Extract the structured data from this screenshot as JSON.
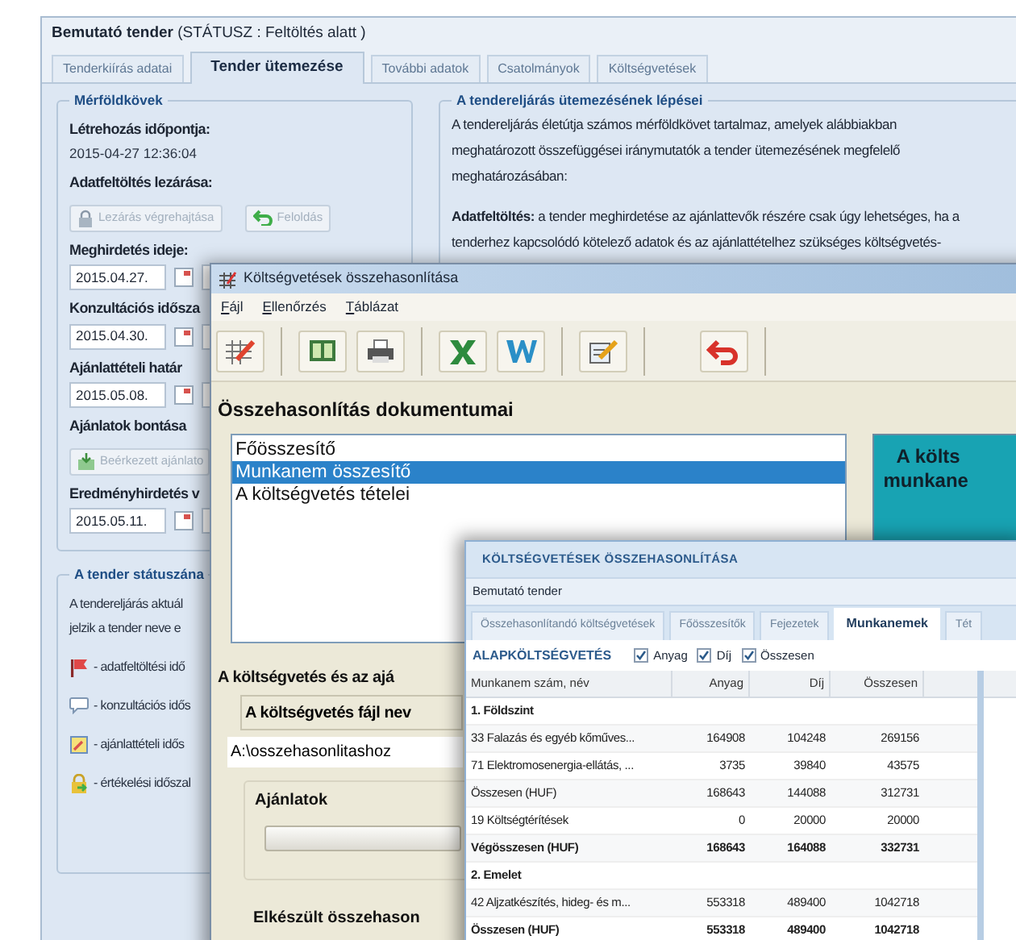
{
  "back_window": {
    "title": "**Bemutató tender** (STÁTUSZ : Feltöltés alatt )",
    "tabs": [
      {
        "label": "Tenderkiírás adatai",
        "selected": false
      },
      {
        "label": "Tender ütemezése",
        "selected": true
      },
      {
        "label": "További adatok",
        "selected": false
      },
      {
        "label": "Csatolmányok",
        "selected": false
      },
      {
        "label": "Költségvetések",
        "selected": false
      }
    ],
    "milestones": {
      "legend": "Mérföldkövek",
      "items": [
        {
          "kind": "label",
          "text": "Létrehozás időpontja:"
        },
        {
          "kind": "value",
          "text": "2015-04-27 12:36:04"
        },
        {
          "kind": "label",
          "text": "Adatfeltöltés lezárása:"
        },
        {
          "kind": "buttons",
          "buttons": [
            {
              "kind": "lock",
              "label": "Lezárás végrehajtása",
              "disabled": true
            },
            {
              "kind": "undo",
              "label": "Feloldás",
              "disabled": true
            }
          ]
        },
        {
          "kind": "label",
          "text": "Meghirdetés ideje:"
        },
        {
          "kind": "date",
          "value": "2015.04.27."
        },
        {
          "kind": "label",
          "text": "Konzultációs idősza"
        },
        {
          "kind": "date",
          "value": "2015.04.30."
        },
        {
          "kind": "label",
          "text": "Ajánlattételi határ"
        },
        {
          "kind": "date",
          "value": "2015.05.08."
        },
        {
          "kind": "label",
          "text": "Ajánlatok bontása"
        },
        {
          "kind": "buttons",
          "buttons": [
            {
              "kind": "inbox",
              "label": "Beérkezett ajánlato",
              "disabled": true
            }
          ]
        },
        {
          "kind": "label",
          "text": "Eredményhirdetés v"
        },
        {
          "kind": "date",
          "value": "2015.05.11."
        }
      ]
    },
    "status": {
      "legend": "A tender státuszána",
      "lines": [
        "A tendereljárás aktuál",
        "jelzik a tender neve e"
      ],
      "legend_items": [
        {
          "kind": "flag",
          "text": "- adatfeltöltési idő"
        },
        {
          "kind": "bubble",
          "text": "- konzultációs idős"
        },
        {
          "kind": "note",
          "text": "- ajánlattételi idős"
        },
        {
          "kind": "lock",
          "text": "- értékelési időszal"
        }
      ]
    },
    "steps": {
      "legend": "A tendereljárás ütemezésének lépései",
      "paragraphs": [
        "A tendereljárás életútja számos mérföldkövet tartalmaz, amelyek alábbiakban meghatározott összefüggései iránymutatók a tender ütemezésének megfelelő meghatározásában:",
        "**Adatfeltöltés:** a tender meghirdetése az ajánlattevők részére csak úgy lehetséges, ha a tenderhez kapcsolódó kötelező adatok és az ajánlattételhez szükséges költségvetés-"
      ]
    }
  },
  "middle_window": {
    "title": "Költségvetések összehasonlítása",
    "menu": [
      "Fájl",
      "Ellenőrzés",
      "Táblázat"
    ],
    "documents_heading": "Összehasonlítás dokumentumai",
    "documents": [
      {
        "label": "Főösszesítő",
        "selected": false
      },
      {
        "label": "Munkanem összesítő",
        "selected": true
      },
      {
        "label": "A költségvetés tételei",
        "selected": false
      }
    ],
    "info_panel": [
      "A költs",
      "munkane"
    ],
    "section_heading": "A költségvetés és az ajá",
    "file_label": "A költségvetés fájl nev",
    "file_path": "A:\\osszehasonlitashoz",
    "offers_heading": "Ajánlatok",
    "done_heading": "Elkészült összehason"
  },
  "front_window": {
    "title": "KÖLTSÉGVETÉSEK ÖSSZEHASONLÍTÁSA",
    "subtitle": "Bemutató tender",
    "tabs": [
      {
        "label": "Összehasonlítandó költségvetések",
        "selected": false
      },
      {
        "label": "Főösszesítők",
        "selected": false
      },
      {
        "label": "Fejezetek",
        "selected": false
      },
      {
        "label": "Munkanemek",
        "selected": true
      },
      {
        "label": "Tét",
        "selected": false
      }
    ],
    "section": "ALAPKÖLTSÉGVETÉS",
    "filters": [
      {
        "label": "Anyag",
        "checked": true
      },
      {
        "label": "Díj",
        "checked": true
      },
      {
        "label": "Összesen",
        "checked": true
      }
    ],
    "table": {
      "columns": [
        "Munkanem szám, név",
        "Anyag",
        "Díj",
        "Összesen"
      ],
      "rows": [
        {
          "kind": "group",
          "cells": [
            "1. Földszint"
          ]
        },
        {
          "kind": "item",
          "cells": [
            "33 Falazás és egyéb kőműves...",
            "164908",
            "104248",
            "269156"
          ]
        },
        {
          "kind": "item",
          "cells": [
            "71 Elektromosenergia-ellátás, ...",
            "3735",
            "39840",
            "43575"
          ]
        },
        {
          "kind": "item",
          "cells": [
            "Összesen (HUF)",
            "168643",
            "144088",
            "312731"
          ]
        },
        {
          "kind": "item",
          "cells": [
            "19 Költségtérítések",
            "0",
            "20000",
            "20000"
          ]
        },
        {
          "kind": "total",
          "cells": [
            "Végösszesen (HUF)",
            "168643",
            "164088",
            "332731"
          ]
        },
        {
          "kind": "group",
          "cells": [
            "2. Emelet"
          ]
        },
        {
          "kind": "item",
          "cells": [
            "42 Aljzatkészítés, hideg- és m...",
            "553318",
            "489400",
            "1042718"
          ]
        },
        {
          "kind": "total",
          "cells": [
            "Összesen (HUF)",
            "553318",
            "489400",
            "1042718"
          ]
        }
      ]
    }
  }
}
